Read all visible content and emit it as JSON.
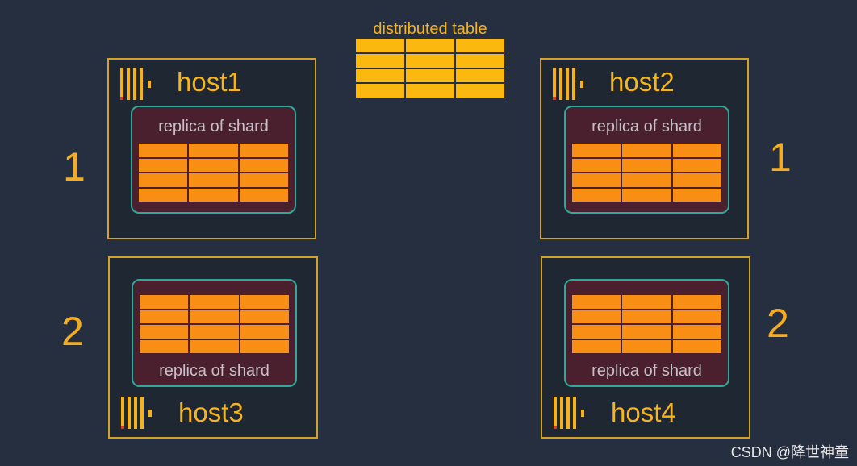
{
  "distributed": {
    "title": "distributed table",
    "rows": 4,
    "cols": 3
  },
  "hosts": [
    {
      "name": "host1",
      "replica_label": "replica of shard"
    },
    {
      "name": "host2",
      "replica_label": "replica of shard"
    },
    {
      "name": "host3",
      "replica_label": "replica of shard"
    },
    {
      "name": "host4",
      "replica_label": "replica of shard"
    }
  ],
  "shards": [
    {
      "label": "1"
    },
    {
      "label": "2"
    }
  ],
  "watermark": "CSDN @降世神童",
  "colors": {
    "background": "#262f40",
    "accent": "#f6b21b",
    "shard_cell": "#f88f14",
    "dist_cell": "#fbb90f",
    "replica_bg": "#4a1f2e",
    "replica_border": "#2fa89a"
  }
}
